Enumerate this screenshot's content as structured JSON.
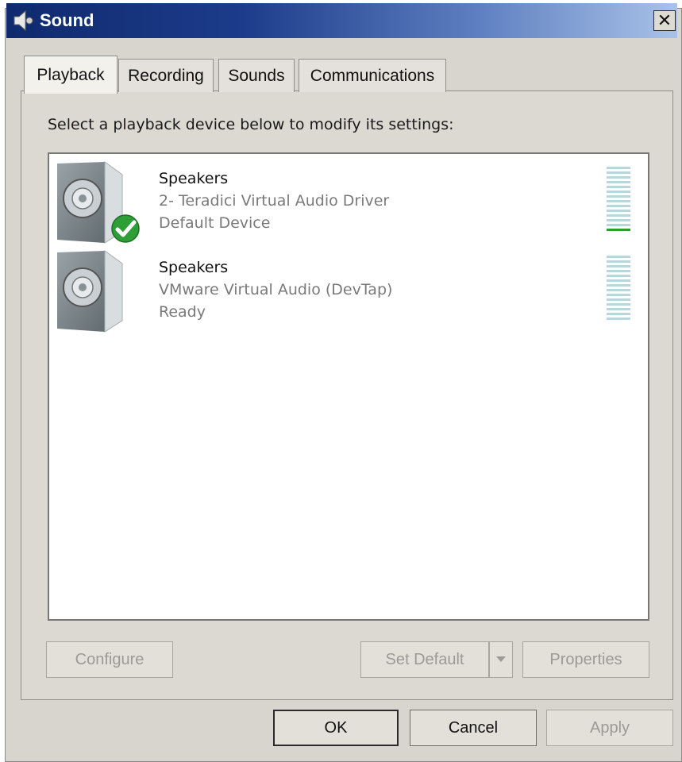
{
  "window": {
    "title": "Sound",
    "close_glyph": "✕"
  },
  "tabs": [
    {
      "label": "Playback",
      "active": true
    },
    {
      "label": "Recording",
      "active": false
    },
    {
      "label": "Sounds",
      "active": false
    },
    {
      "label": "Communications",
      "active": false
    }
  ],
  "playback": {
    "instructions": "Select a playback device below to modify its settings:",
    "devices": [
      {
        "name": "Speakers",
        "driver": "2- Teradici Virtual Audio Driver",
        "status": "Default Device",
        "is_default": true,
        "icon": "speaker-icon",
        "badge_icon": "check-icon",
        "level_fraction": 0.1
      },
      {
        "name": "Speakers",
        "driver": "VMware Virtual Audio (DevTap)",
        "status": "Ready",
        "is_default": false,
        "icon": "speaker-icon",
        "level_fraction": 0
      }
    ],
    "buttons": {
      "configure": "Configure",
      "set_default": "Set Default",
      "properties": "Properties"
    }
  },
  "footer": {
    "ok": "OK",
    "cancel": "Cancel",
    "apply": "Apply"
  },
  "colors": {
    "title_gradient_start": "#0f2a6e",
    "title_gradient_end": "#a9c2e8",
    "meter_lit": "#2a9e2a",
    "meter_idle": "#bcd6dd",
    "default_badge": "#2e9e36"
  }
}
